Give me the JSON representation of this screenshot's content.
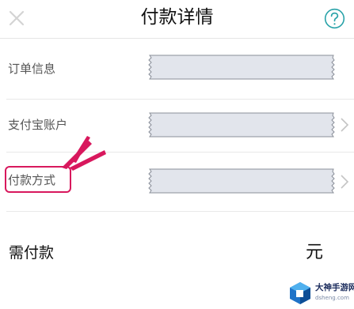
{
  "header": {
    "title": "付款详情",
    "close_icon": "close-icon",
    "help_icon": "question-circle-icon"
  },
  "rows": [
    {
      "label": "订单信息",
      "value_redacted": true,
      "has_chevron": false
    },
    {
      "label": "支付宝账户",
      "value_redacted": true,
      "has_chevron": true
    },
    {
      "label": "付款方式",
      "value_redacted": true,
      "has_chevron": true,
      "highlighted": true
    }
  ],
  "amount": {
    "label": "需付款",
    "unit": "元"
  },
  "watermark": {
    "text": "大神手游网",
    "url": "dsheng.com"
  },
  "colors": {
    "highlight": "#d8185d",
    "help_icon": "#2aa3a9",
    "close_icon": "#cfcfcf",
    "redaction_fill": "#e2e5ec",
    "redaction_stroke": "#8a8f99"
  }
}
